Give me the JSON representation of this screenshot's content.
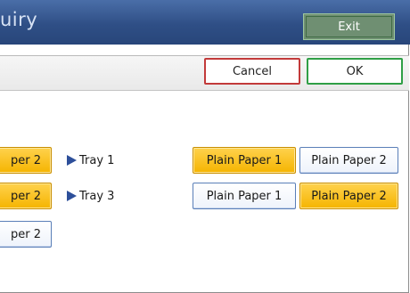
{
  "header": {
    "title": "uiry",
    "exit_label": "Exit"
  },
  "actions": {
    "cancel_label": "Cancel",
    "ok_label": "OK"
  },
  "left_column": [
    {
      "label": "per 2",
      "state": "selected"
    },
    {
      "label": "per 2",
      "state": "selected"
    },
    {
      "label": "per 2",
      "state": "unselected"
    }
  ],
  "trays": [
    {
      "name": "Tray 1",
      "options": [
        {
          "label": "Plain Paper 1",
          "selected": true
        },
        {
          "label": "Plain Paper 2",
          "selected": false
        }
      ]
    },
    {
      "name": "Tray 3",
      "options": [
        {
          "label": "Plain Paper 1",
          "selected": false
        },
        {
          "label": "Plain Paper 2",
          "selected": true
        }
      ]
    }
  ],
  "colors": {
    "selected": "#f5b400",
    "unselected_border": "#5a7fb8",
    "cancel_border": "#c23a3a",
    "ok_border": "#2f9f46",
    "header": "#2f4f86"
  }
}
